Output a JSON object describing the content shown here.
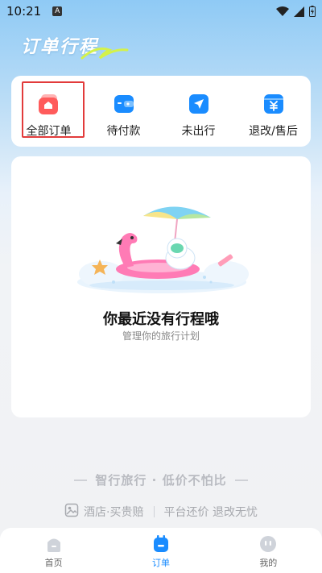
{
  "status_bar": {
    "time": "10:21",
    "notification_badge": "A",
    "icons": [
      "wifi-icon",
      "signal-icon",
      "battery-charging-icon"
    ]
  },
  "header": {
    "title": "订单行程"
  },
  "order_tabs": [
    {
      "label": "全部订单",
      "icon": "all-orders-icon",
      "color": "#ff5b5b",
      "selected": true
    },
    {
      "label": "待付款",
      "icon": "wallet-icon",
      "color": "#1a8cff",
      "selected": false
    },
    {
      "label": "未出行",
      "icon": "paper-plane-icon",
      "color": "#1a8cff",
      "selected": false
    },
    {
      "label": "退改/售后",
      "icon": "refund-icon",
      "color": "#1a8cff",
      "selected": false
    }
  ],
  "empty_state": {
    "title": "你最近没有行程哦",
    "subtitle": "管理你的旅行计划",
    "illustration": "flamingo-float-astronaut-umbrella"
  },
  "slogan": {
    "text": "智行旅行 · 低价不怕比"
  },
  "guarantees": {
    "left": "酒店·买贵赔",
    "right": "平台还价 退改无忧"
  },
  "bottom_nav": [
    {
      "label": "首页",
      "icon": "home-icon",
      "active": false
    },
    {
      "label": "订单",
      "icon": "orders-icon",
      "active": true
    },
    {
      "label": "我的",
      "icon": "profile-icon",
      "active": false
    }
  ],
  "colors": {
    "accent": "#1a8cff",
    "highlight_border": "#e23b3b",
    "tab_red": "#ff5b5b"
  }
}
